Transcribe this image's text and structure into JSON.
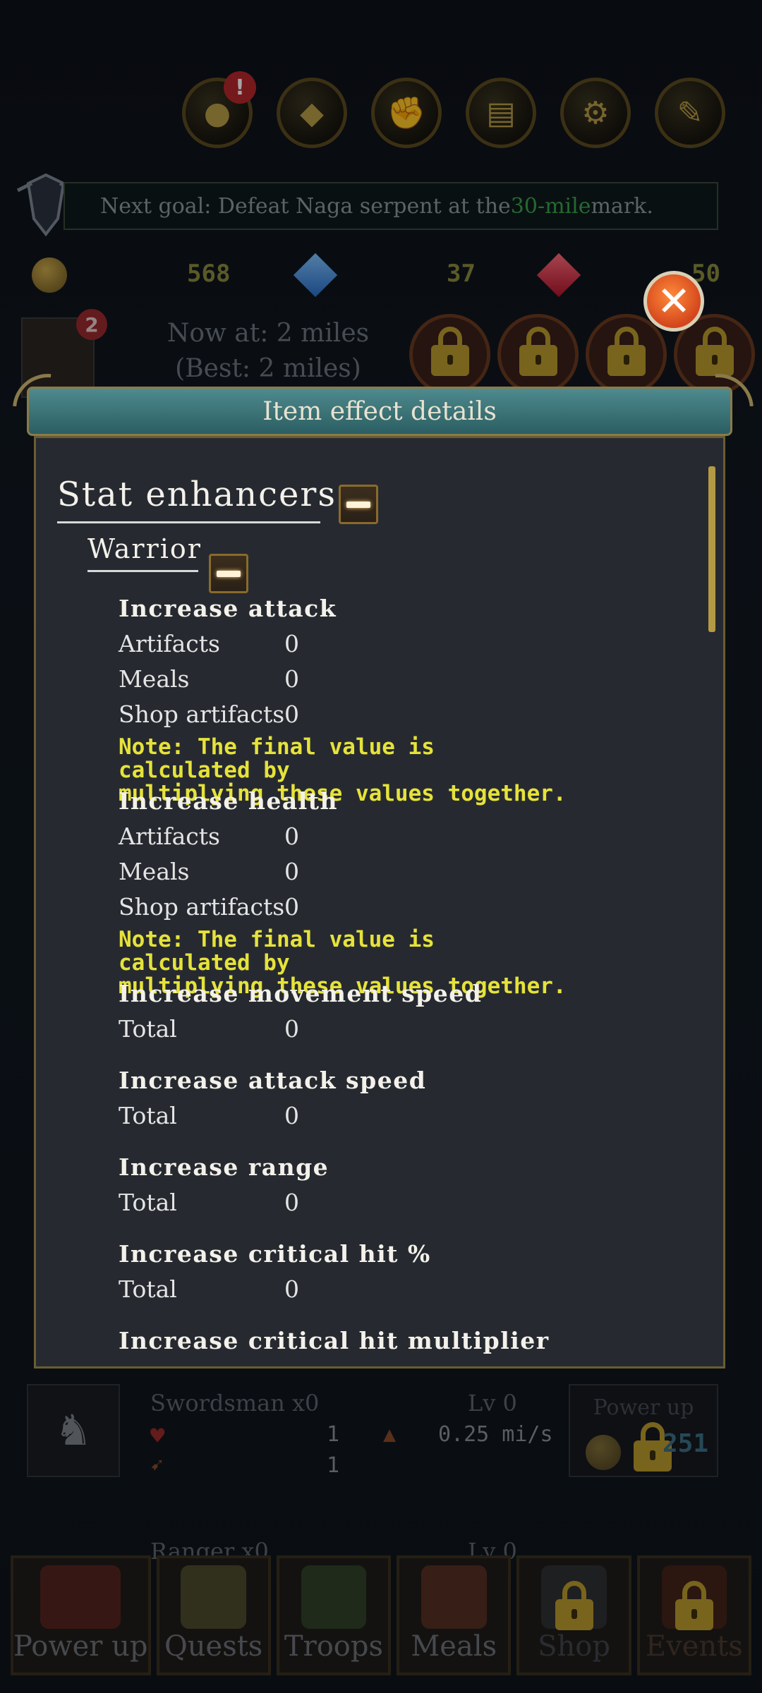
{
  "background": {
    "goal_text_prefix": "Next goal: Defeat Naga serpent at the ",
    "goal_text_highlight": "30-mile",
    "goal_text_suffix": " mark.",
    "gold": "568",
    "diamonds": "37",
    "rubies": "50",
    "troop_badge_count": "2",
    "now_at": "Now at: 2 miles",
    "best": "(Best: 2 miles)",
    "units": [
      {
        "name": "Swordsman x0",
        "level": "Lv 0",
        "hp": "1",
        "attack": "1",
        "speed": "0.25 mi/s",
        "powerup_label": "Power up",
        "powerup_cost": "251"
      },
      {
        "name": "Ranger x0",
        "level": "Lv 0"
      }
    ],
    "nav_tabs": [
      "Power up",
      "Quests",
      "Troops",
      "Meals",
      "Shop",
      "Events"
    ]
  },
  "modal": {
    "title": "Item effect details",
    "section_title": "Stat enhancers",
    "subsection_title": "Warrior",
    "stats": [
      {
        "title": "Increase attack",
        "rows": [
          {
            "label": "Artifacts",
            "value": "0"
          },
          {
            "label": "Meals",
            "value": "0"
          },
          {
            "label": "Shop artifacts",
            "value": "0"
          }
        ],
        "note_line1": "Note: The final value is calculated by",
        "note_line2": "multiplying these values together."
      },
      {
        "title": "Increase health",
        "rows": [
          {
            "label": "Artifacts",
            "value": "0"
          },
          {
            "label": "Meals",
            "value": "0"
          },
          {
            "label": "Shop artifacts",
            "value": "0"
          }
        ],
        "note_line1": "Note: The final value is calculated by",
        "note_line2": "multiplying these values together."
      },
      {
        "title": "Increase movement speed",
        "rows": [
          {
            "label": "Total",
            "value": "0"
          }
        ]
      },
      {
        "title": "Increase attack speed",
        "rows": [
          {
            "label": "Total",
            "value": "0"
          }
        ]
      },
      {
        "title": "Increase range",
        "rows": [
          {
            "label": "Total",
            "value": "0"
          }
        ]
      },
      {
        "title": "Increase critical hit %",
        "rows": [
          {
            "label": "Total",
            "value": "0"
          }
        ]
      },
      {
        "title": "Increase critical hit multiplier"
      }
    ]
  },
  "icons": {
    "close": "close-icon",
    "collapse": "minus-icon",
    "lock": "lock-icon"
  },
  "colors": {
    "note": "#e6e23a",
    "modal_bg": "#262a30",
    "header": "#3d7478",
    "close_btn": "#e8602a",
    "scrollbar": "#b59a45"
  }
}
